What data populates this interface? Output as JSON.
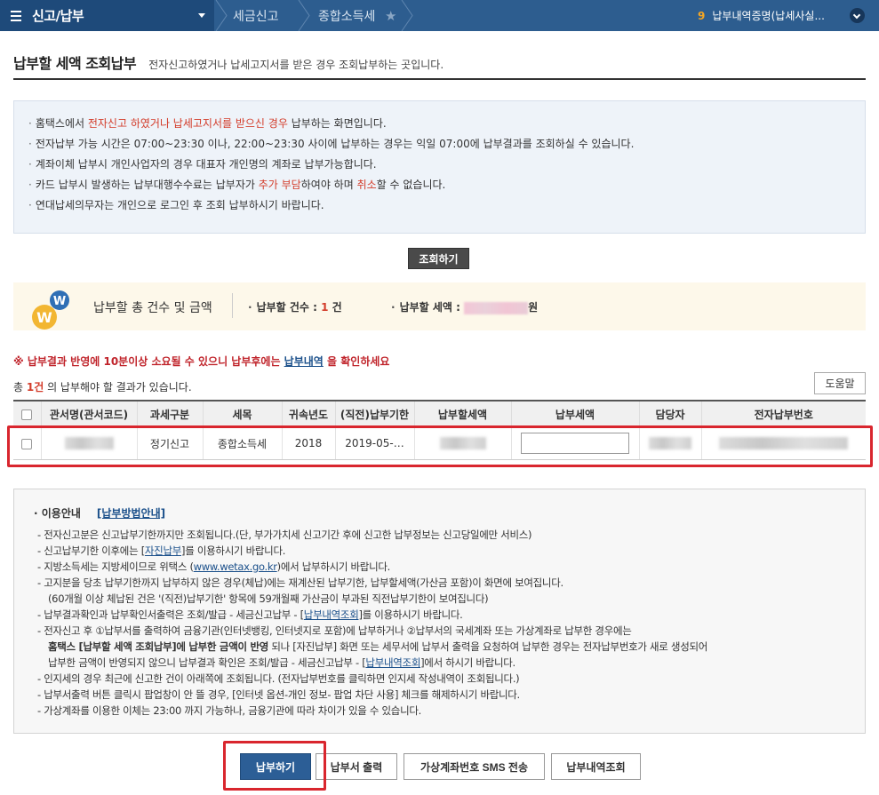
{
  "nav": {
    "menu_title": "신고/납부",
    "crumb1": "세금신고",
    "crumb2": "종합소득세",
    "right_num": "9",
    "right_text": "납부내역증명(납세사실..."
  },
  "page": {
    "title": "납부할 세액 조회납부",
    "subtitle": "전자신고하였거나 납세고지서를 받은 경우 조회납부하는 곳입니다."
  },
  "info": {
    "l1_a": "홈택스에서 ",
    "l1_red": "전자신고 하였거나 납세고지서를 받으신 경우",
    "l1_b": " 납부하는 화면입니다.",
    "l2": "전자납부 가능 시간은 07:00~23:30 이나, 22:00~23:30 사이에 납부하는 경우는 익일 07:00에 납부결과를 조회하실 수 있습니다.",
    "l3": "계좌이체 납부시 개인사업자의 경우 대표자 개인명의 계좌로 납부가능합니다.",
    "l4_a": "카드 납부시 발생하는 납부대행수수료는 납부자가 ",
    "l4_red1": "추가 부담",
    "l4_b": "하여야 하며 ",
    "l4_red2": "취소",
    "l4_c": "할 수 없습니다.",
    "l5": "연대납세의무자는 개인으로 로그인 후 조회 납부하시기 바랍니다."
  },
  "search_button": "조회하기",
  "summary": {
    "title": "납부할 총 건수 및 금액",
    "count_label": "납부할 건수 : ",
    "count_value": "1",
    "count_unit": " 건",
    "amount_label": "납부할 세액 : ",
    "amount_unit": "원"
  },
  "warning": {
    "a": "※ 납부결과 반영에 10분이상 소요될 수 있으니 납부후에는 ",
    "link": "납부내역",
    "b": " 을 확인하세요"
  },
  "total": {
    "a": "총 ",
    "count": "1건",
    "b": " 의 납부해야 할 결과가 있습니다."
  },
  "help_button": "도움말",
  "table": {
    "headers": [
      "관서명(관서코드)",
      "과세구분",
      "세목",
      "귀속년도",
      "(직전)납부기한",
      "납부할세액",
      "납부세액",
      "담당자",
      "전자납부번호"
    ],
    "row": {
      "type": "정기신고",
      "item": "종합소득세",
      "year": "2018",
      "due": "2019-05-…"
    }
  },
  "guide": {
    "head": "· 이용안내",
    "head_link": "[납부방법안내]",
    "g1": "- 전자신고분은 신고납부기한까지만 조회됩니다.(단, 부가가치세 신고기간 후에 신고한 납부정보는 신고당일에만 서비스)",
    "g2_a": "- 신고납부기한 이후에는 [",
    "g2_link": "자진납부",
    "g2_b": "]를 이용하시기 바랍니다.",
    "g3_a": "- 지방소득세는 지방세이므로 위택스 (",
    "g3_link": "www.wetax.go.kr",
    "g3_b": ")에서 납부하시기 바랍니다.",
    "g4": "- 고지분을 당초 납부기한까지 납부하지 않은 경우(체납)에는 재계산된 납부기한, 납부할세액(가산금 포함)이 화면에 보여집니다.",
    "g5": "(60개월 이상 체납된 건은 '(직전)납부기한' 항목에 59개월째 가산금이 부과된 직전납부기한이 보여집니다)",
    "g6_a": "- 납부결과확인과 납부확인서출력은 조회/발급 - 세금신고납부 - [",
    "g6_link": "납부내역조회",
    "g6_b": "]를 이용하시기 바랍니다.",
    "g7": "- 전자신고 후 ①납부서를 출력하여 금융기관(인터넷뱅킹, 인터넷지로 포함)에 납부하거나 ②납부서의 국세계좌 또는 가상계좌로 납부한 경우에는",
    "g8_bold": "홈택스 [납부할 세액 조회납부]에 납부한 금액이 반영",
    "g8_rest": " 되나 [자진납부] 화면 또는 세무서에 납부서 출력을 요청하여 납부한 경우는 전자납부번호가 새로 생성되어",
    "g9_a": "납부한 금액이 반영되지 않으니 납부결과 확인은 조회/발급 - 세금신고납부 - [",
    "g9_link": "납부내역조회",
    "g9_b": "]에서 하시기 바랍니다.",
    "g10": "- 인지세의 경우 최근에 신고한 건이 아래쪽에 조회됩니다. (전자납부번호를 클릭하면 인지세 작성내역이 조회됩니다.)",
    "g11": "- 납부서출력 버튼 클릭시 팝업창이 안 뜰 경우, [인터넷 옵션-개인 정보- 팝업 차단 사용] 체크를 해제하시기 바랍니다.",
    "g12": "- 가상계좌를 이용한 이체는 23:00 까지 가능하나, 금융기관에 따라 차이가 있을 수 있습니다."
  },
  "buttons": {
    "pay": "납부하기",
    "print": "납부서 출력",
    "sms": "가상계좌번호 SMS 전송",
    "history": "납부내역조회"
  },
  "colors": {
    "nav_bg": "#2d5d8f",
    "accent_red": "#d33c2a",
    "highlight_box": "#d9262e",
    "primary_button": "#2c5e96"
  }
}
